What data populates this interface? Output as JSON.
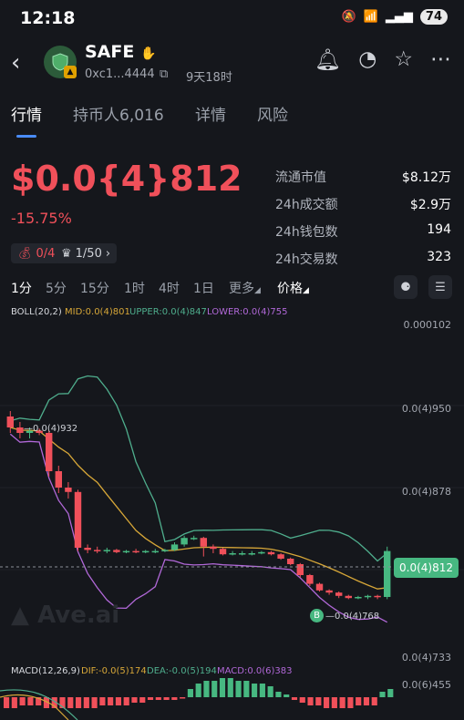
{
  "status_bar": {
    "time": "12:18",
    "battery": "74"
  },
  "header": {
    "name": "SAFE",
    "address": "0xc1...4444",
    "age": "9天18时"
  },
  "tabs": [
    {
      "label": "行情"
    },
    {
      "label": "持币人6,016"
    },
    {
      "label": "详情"
    },
    {
      "label": "风险"
    }
  ],
  "price": {
    "value": "$0.0{4}812",
    "change": "-15.75%"
  },
  "stats": [
    {
      "label": "流通市值",
      "value": "$8.12万"
    },
    {
      "label": "24h成交额",
      "value": "$2.9万"
    },
    {
      "label": "24h钱包数",
      "value": "194"
    },
    {
      "label": "24h交易数",
      "value": "323"
    }
  ],
  "pills": {
    "bag": "0/4",
    "crown": "1/50"
  },
  "timeframes": [
    "1分",
    "5分",
    "15分",
    "1时",
    "4时",
    "1日",
    "更多"
  ],
  "price_mode": "价格",
  "boll": {
    "title": "BOLL(20,2)",
    "mid": "MID:0.0(4)801",
    "upper": "UPPER:0.0(4)847",
    "lower": "LOWER:0.0(4)755"
  },
  "y_axis": {
    "t1": "0.000102",
    "t2": "0.0(4)950",
    "t3": "0.0(4)878",
    "t4": "0.0(4)733",
    "t5": "0.0(6)455"
  },
  "annotations": {
    "high": "0.0(4)932",
    "low": "0.0(4)768",
    "current": "0.0(4)812"
  },
  "watermark": "Ave.ai",
  "macd": {
    "title": "MACD(12,26,9)",
    "dif": "DIF:-0.0(5)174",
    "dea": "DEA:-0.0(5)194",
    "macd": "MACD:0.0(6)383"
  },
  "colors": {
    "up": "#47b881",
    "down": "#f0505a",
    "upper": "#4fae8d",
    "mid": "#d7a738",
    "lower": "#b168d8",
    "accent": "#4a8cf7"
  },
  "candles": [
    {
      "o": 9.35e-05,
      "c": 9.25e-05,
      "h": 9.4e-05,
      "l": 9.2e-05
    },
    {
      "o": 9.25e-05,
      "c": 9.2e-05,
      "h": 9.3e-05,
      "l": 9.15e-05
    },
    {
      "o": 9.2e-05,
      "c": 9.22e-05,
      "h": 9.25e-05,
      "l": 9.15e-05
    },
    {
      "o": 9.22e-05,
      "c": 9.2e-05,
      "h": 9.24e-05,
      "l": 9.18e-05
    },
    {
      "o": 9.2e-05,
      "c": 8.85e-05,
      "h": 9.22e-05,
      "l": 8.8e-05
    },
    {
      "o": 8.85e-05,
      "c": 8.7e-05,
      "h": 8.9e-05,
      "l": 8.65e-05
    },
    {
      "o": 8.7e-05,
      "c": 8.66e-05,
      "h": 8.75e-05,
      "l": 8.6e-05
    },
    {
      "o": 8.66e-05,
      "c": 8.15e-05,
      "h": 8.68e-05,
      "l": 8.12e-05
    },
    {
      "o": 8.15e-05,
      "c": 8.13e-05,
      "h": 8.18e-05,
      "l": 8.1e-05
    },
    {
      "o": 8.13e-05,
      "c": 8.12e-05,
      "h": 8.16e-05,
      "l": 8.1e-05
    },
    {
      "o": 8.12e-05,
      "c": 8.13e-05,
      "h": 8.15e-05,
      "l": 8.1e-05
    },
    {
      "o": 8.13e-05,
      "c": 8.11e-05,
      "h": 8.14e-05,
      "l": 8.1e-05
    },
    {
      "o": 8.11e-05,
      "c": 8.12e-05,
      "h": 8.13e-05,
      "l": 8.1e-05
    },
    {
      "o": 8.12e-05,
      "c": 8.11e-05,
      "h": 8.14e-05,
      "l": 8.1e-05
    },
    {
      "o": 8.11e-05,
      "c": 8.12e-05,
      "h": 8.13e-05,
      "l": 8.1e-05
    },
    {
      "o": 8.12e-05,
      "c": 8.12e-05,
      "h": 8.14e-05,
      "l": 8.1e-05
    },
    {
      "o": 8.12e-05,
      "c": 8.13e-05,
      "h": 8.14e-05,
      "l": 8.11e-05
    },
    {
      "o": 8.13e-05,
      "c": 8.18e-05,
      "h": 8.2e-05,
      "l": 8.12e-05
    },
    {
      "o": 8.18e-05,
      "c": 8.24e-05,
      "h": 8.26e-05,
      "l": 8.16e-05
    },
    {
      "o": 8.24e-05,
      "c": 8.24e-05,
      "h": 8.26e-05,
      "l": 8.22e-05
    },
    {
      "o": 8.24e-05,
      "c": 8.16e-05,
      "h": 8.25e-05,
      "l": 8.07e-05
    },
    {
      "o": 8.16e-05,
      "c": 8.14e-05,
      "h": 8.18e-05,
      "l": 8.1e-05
    },
    {
      "o": 8.14e-05,
      "c": 8.09e-05,
      "h": 8.15e-05,
      "l": 8.08e-05
    },
    {
      "o": 8.09e-05,
      "c": 8.1e-05,
      "h": 8.12e-05,
      "l": 8.08e-05
    },
    {
      "o": 8.1e-05,
      "c": 8.1e-05,
      "h": 8.12e-05,
      "l": 8.08e-05
    },
    {
      "o": 8.1e-05,
      "c": 8.1e-05,
      "h": 8.12e-05,
      "l": 8.08e-05
    },
    {
      "o": 8.1e-05,
      "c": 8.11e-05,
      "h": 8.12e-05,
      "l": 8.09e-05
    },
    {
      "o": 8.11e-05,
      "c": 8.09e-05,
      "h": 8.12e-05,
      "l": 8.08e-05
    },
    {
      "o": 8.09e-05,
      "c": 8.05e-05,
      "h": 8.1e-05,
      "l": 8.04e-05
    },
    {
      "o": 8.05e-05,
      "c": 8e-05,
      "h": 8.06e-05,
      "l": 7.99e-05
    },
    {
      "o": 8e-05,
      "c": 7.9e-05,
      "h": 8.01e-05,
      "l": 7.88e-05
    },
    {
      "o": 7.9e-05,
      "c": 7.82e-05,
      "h": 7.91e-05,
      "l": 7.8e-05
    },
    {
      "o": 7.82e-05,
      "c": 7.76e-05,
      "h": 7.83e-05,
      "l": 7.75e-05
    },
    {
      "o": 7.76e-05,
      "c": 7.74e-05,
      "h": 7.77e-05,
      "l": 7.72e-05
    },
    {
      "o": 7.74e-05,
      "c": 7.71e-05,
      "h": 7.75e-05,
      "l": 7.69e-05
    },
    {
      "o": 7.71e-05,
      "c": 7.69e-05,
      "h": 7.72e-05,
      "l": 7.68e-05
    },
    {
      "o": 7.69e-05,
      "c": 7.7e-05,
      "h": 7.71e-05,
      "l": 7.68e-05
    },
    {
      "o": 7.7e-05,
      "c": 7.71e-05,
      "h": 7.72e-05,
      "l": 7.68e-05
    },
    {
      "o": 7.71e-05,
      "c": 7.7e-05,
      "h": 7.72e-05,
      "l": 7.68e-05
    },
    {
      "o": 7.7e-05,
      "c": 8.12e-05,
      "h": 8.16e-05,
      "l": 7.68e-05
    }
  ],
  "macd_bars": [
    -4,
    -4,
    -3,
    -3,
    -3,
    -4,
    -4,
    -4,
    -4,
    -4,
    -4,
    -4,
    -3,
    -3,
    -3,
    -3,
    -2,
    -2,
    -1,
    -1,
    -1,
    -1,
    -0.5,
    3,
    5,
    6,
    6,
    7,
    7,
    6,
    6,
    5,
    5,
    4,
    2,
    1,
    -1,
    -2,
    -3,
    -3,
    -4,
    -4,
    -4,
    -4,
    -3,
    -3,
    -3,
    2,
    3
  ]
}
